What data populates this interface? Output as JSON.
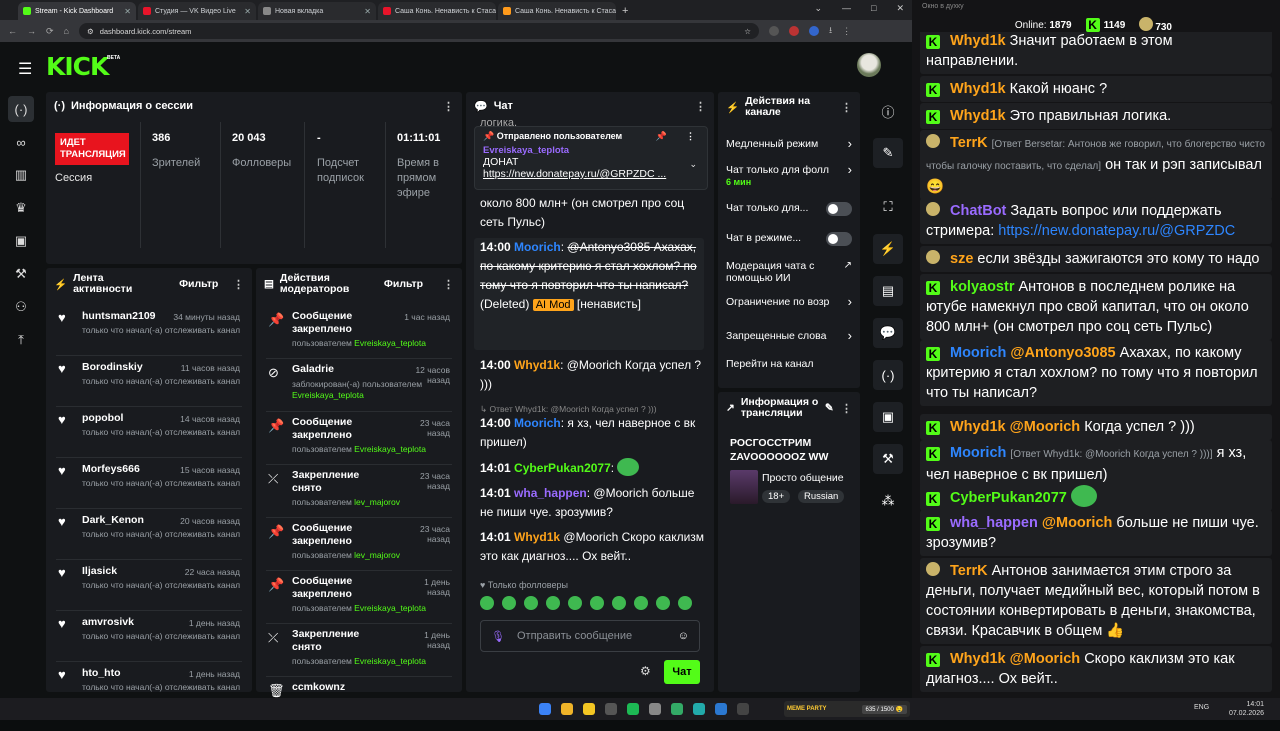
{
  "browser": {
    "tabs": [
      {
        "label": "Stream - Kick Dashboard",
        "color": "#53fc18",
        "active": true
      },
      {
        "label": "Студия — VK Видео Live",
        "color": "#e8142a"
      },
      {
        "label": "Новая вкладка",
        "color": "#888888"
      },
      {
        "label": "Саша Конь. Ненависть к Стаса",
        "color": "#e8142a"
      },
      {
        "label": "Саша Конь. Ненависть к Стаса",
        "color": "#ff9a1b"
      }
    ],
    "url": "dashboard.kick.com/stream"
  },
  "app": {
    "logo": "KICK",
    "beta": "BETA"
  },
  "session": {
    "title": "Информация о сессии",
    "live": "ИДЕТ ТРАНСЛЯЦИЯ",
    "live_sub": "Сессия",
    "viewers": "386",
    "viewers_label": "Зрителей",
    "followers": "20 043",
    "followers_label": "Фолловеры",
    "subs": "-",
    "subs_label": "Подсчет подписок",
    "uptime": "01:11:01",
    "uptime_label": "Время в прямом эфире"
  },
  "activity": {
    "title": "Лента активности",
    "filter": "Фильтр",
    "sub": "только что начал(-а) отслеживать канал",
    "items": [
      {
        "name": "huntsman2109",
        "time": "34 минуты назад"
      },
      {
        "name": "Borodinskiy",
        "time": "11 часов назад"
      },
      {
        "name": "popobol",
        "time": "14 часов назад"
      },
      {
        "name": "Morfeys666",
        "time": "15 часов назад"
      },
      {
        "name": "Dark_Kenon",
        "time": "20 часов назад"
      },
      {
        "name": "Iljasick",
        "time": "22 часа назад"
      },
      {
        "name": "amvrosivk",
        "time": "1 день назад"
      },
      {
        "name": "hto_hto",
        "time": "1 день назад"
      }
    ]
  },
  "modactions": {
    "title": "Действия модераторов",
    "filter": "Фильтр",
    "items": [
      {
        "action": "Сообщение закреплено",
        "time": "1 час назад",
        "by": "пользователем ",
        "user": "Evreiskaya_teplota",
        "icon": "pin"
      },
      {
        "action": "Galadrie",
        "time": "12 часов назад",
        "by": "заблокирован(-а) пользователем ",
        "user": "Evreiskaya_teplota",
        "icon": "ban"
      },
      {
        "action": "Сообщение закреплено",
        "time": "23 часа назад",
        "by": "пользователем ",
        "user": "Evreiskaya_teplota",
        "icon": "pin"
      },
      {
        "action": "Закрепление снято",
        "time": "23 часа назад",
        "by": "пользователем ",
        "user": "lev_majorov",
        "icon": "unpin"
      },
      {
        "action": "Сообщение закреплено",
        "time": "23 часа назад",
        "by": "пользователем ",
        "user": "lev_majorov",
        "icon": "pin"
      },
      {
        "action": "Сообщение закреплено",
        "time": "1 день назад",
        "by": "пользователем ",
        "user": "Evreiskaya_teplota",
        "icon": "pin"
      },
      {
        "action": "Закрепление снято",
        "time": "1 день назад",
        "by": "пользователем ",
        "user": "Evreiskaya_teplota",
        "icon": "unpin"
      },
      {
        "action": "ccmkownz",
        "time": "",
        "by": "",
        "user": "",
        "icon": "trash"
      }
    ]
  },
  "chat": {
    "title": "Чат",
    "top_fragment": "логика.",
    "pinned": {
      "label": "Отправлено пользователем",
      "user": "Evreiskaya_teplota",
      "title": "ДОНАТ",
      "link": "https://new.donatepay.ru/@GRPZDC ..."
    },
    "fragment2": "около 800 млн+ (он смотрел про соц сеть Пульс)",
    "deleted": {
      "time": "14:00",
      "user": "Moorich",
      "mention": "@Antonyo3085",
      "text": "Ахахах, по какому критерию я стал хохлом? по тому что я повторил что ты написал?",
      "deleted": "(Deleted)",
      "mod": "AI Mod",
      "reason": "[ненависть]"
    },
    "m1": {
      "time": "14:00",
      "user": "Whyd1k",
      "text": "@Moorich Когда успел ? )))"
    },
    "reply_hint": "Ответ Whyd1k: @Moorich Когда успел ? )))",
    "m2": {
      "time": "14:00",
      "user": "Moorich",
      "text": "я хз, чел наверное с вк пришел)"
    },
    "m3": {
      "time": "14:01",
      "user": "CyberPukan2077",
      "text": ""
    },
    "m4": {
      "time": "14:01",
      "user": "wha_happen",
      "text": "@Moorich больше не пиши чуе. зрозумив?"
    },
    "m5": {
      "time": "14:01",
      "user": "Whyd1k",
      "text": "@Moorich Скоро каклизм это как диагноз.... Ох вейт.."
    },
    "followers_only": "Только фолловеры",
    "placeholder": "Отправить сообщение",
    "send": "Чат"
  },
  "actions": {
    "title": "Действия на канале",
    "items": [
      {
        "label": "Медленный режим",
        "type": "chev"
      },
      {
        "label": "Чат только для фолл",
        "extra": "6 мин",
        "type": "chev"
      },
      {
        "label": "Чат только для...",
        "type": "toggle"
      },
      {
        "label": "Чат в режиме...",
        "type": "toggle"
      },
      {
        "label": "Модерация чата с помощью ИИ",
        "type": "ext"
      },
      {
        "label": "Ограничение по возр",
        "type": "chev"
      },
      {
        "label": "Запрещенные слова",
        "type": "chev"
      },
      {
        "label": "Перейти на канал",
        "type": "none"
      }
    ]
  },
  "streaminfo": {
    "title": "Информация о трансляции",
    "name": "РОСГОССТРИМ ZAVOOOOOOZ WW",
    "category": "Просто общение",
    "age": "18+",
    "lang": "Russian"
  },
  "rightwin": {
    "title": "Окно в духку",
    "online_label": "Online:",
    "online": "1879",
    "k_count": "1149",
    "f_count": "730"
  },
  "rchat": [
    {
      "kind": "k",
      "user": "Whyd1k",
      "text": "Значит работаем в этом направлении.",
      "ucolor": "#ffa41b"
    },
    {
      "kind": "k",
      "user": "Whyd1k",
      "text": "Какой нюанс ?",
      "ucolor": "#ffa41b"
    },
    {
      "kind": "k",
      "user": "Whyd1k",
      "text": "Это правильная логика.",
      "ucolor": "#ffa41b"
    },
    {
      "kind": "f",
      "user": "TerrK",
      "reply": "[Ответ Bersetar: Антонов же говорил, что блогерство чисто чтобы галочку поставить, что сделал]",
      "text": "он так и рэп записывал 😄",
      "ucolor": "#ffa41b"
    },
    {
      "kind": "f",
      "user": "ChatBot",
      "text": "Задать вопрос или поддержать стримера:",
      "link": "https://new.donatepay.ru/@GRPZDC",
      "ucolor": "#9a6bff"
    },
    {
      "kind": "f",
      "user": "sze",
      "text": "если звёзды зажигаются это кому то надо",
      "ucolor": "#ffa41b"
    },
    {
      "kind": "k",
      "user": "kolyaostr",
      "text": "Антонов в последнем ролике на ютубе намекнул про свой капитал, что он около 800 млн+ (он смотрел про соц сеть Пульс)",
      "ucolor": "#53fc18"
    },
    {
      "kind": "k",
      "user": "Moorich",
      "mention": "@Antonyo3085",
      "text": "Ахахах, по какому критерию я стал хохлом? по тому что я повторил что ты написал?",
      "ucolor": "#2e86ff"
    },
    {
      "kind": "k",
      "user": "Whyd1k",
      "mention": "@Moorich",
      "text": "Когда успел ? )))",
      "ucolor": "#ffa41b"
    },
    {
      "kind": "k",
      "user": "Moorich",
      "reply": "[Ответ Whyd1k: @Moorich Когда успел ? )))]",
      "text": "я хз, чел наверное с вк пришел)",
      "ucolor": "#2e86ff"
    },
    {
      "kind": "k",
      "user": "CyberPukan2077",
      "text": "",
      "ucolor": "#53fc18"
    },
    {
      "kind": "k",
      "user": "wha_happen",
      "mention": "@Moorich",
      "text": "больше не пиши чуе. зрозумив?",
      "ucolor": "#9a6bff"
    },
    {
      "kind": "f",
      "user": "TerrK",
      "text": "Антонов занимается этим строго за деньги, получает медийный вес, который потом в состоянии конвертировать в деньги, знакомства, связи. Красавчик в общем 👍",
      "ucolor": "#ffa41b"
    },
    {
      "kind": "k",
      "user": "Whyd1k",
      "mention": "@Moorich",
      "text": "Скоро каклизм это как диагноз.... Ох вейт..",
      "ucolor": "#ffa41b"
    }
  ],
  "taskbar": {
    "time": "14:01",
    "date": "07.02.2026",
    "lang": "ENG",
    "meme": "MEME PARTY",
    "progress": "635 / 1500 🤤"
  }
}
